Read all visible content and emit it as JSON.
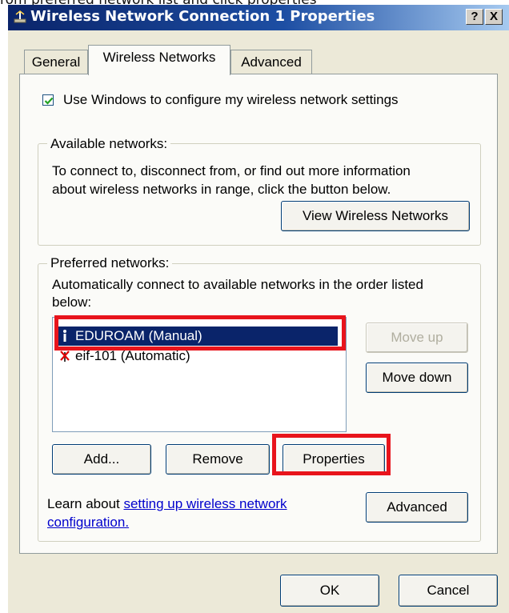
{
  "caption": "rom preferred network list and click properties",
  "window": {
    "title": "Wireless Network Connection 1 Properties",
    "help_btn": "?",
    "close_btn": "X"
  },
  "tabs": [
    {
      "label": "General"
    },
    {
      "label": "Wireless Networks"
    },
    {
      "label": "Advanced"
    }
  ],
  "use_windows_checkbox": {
    "label": "Use Windows to configure my wireless network settings",
    "checked": true
  },
  "available": {
    "legend": "Available networks:",
    "desc_line1": "To connect to, disconnect from, or find out more information",
    "desc_line2": "about wireless networks in range, click the button below.",
    "view_button": "View Wireless Networks"
  },
  "preferred": {
    "legend": "Preferred networks:",
    "desc_line1": "Automatically connect to available networks in the order listed",
    "desc_line2": "below:",
    "networks": [
      {
        "name": "EDUROAM (Manual)",
        "icon": "network-antenna-icon",
        "selected": true
      },
      {
        "name": "eif-101 (Automatic)",
        "icon": "network-unavailable-icon",
        "selected": false
      }
    ],
    "move_up": "Move up",
    "move_down": "Move down",
    "add": "Add...",
    "remove": "Remove",
    "properties": "Properties",
    "learn_prefix": "Learn about ",
    "learn_link_line1": "setting up wireless network",
    "learn_link_line2": "configuration.",
    "advanced": "Advanced"
  },
  "footer": {
    "ok": "OK",
    "cancel": "Cancel"
  },
  "colors": {
    "highlight": "#e8141c",
    "selection": "#0a246a",
    "link": "#0000cc"
  }
}
